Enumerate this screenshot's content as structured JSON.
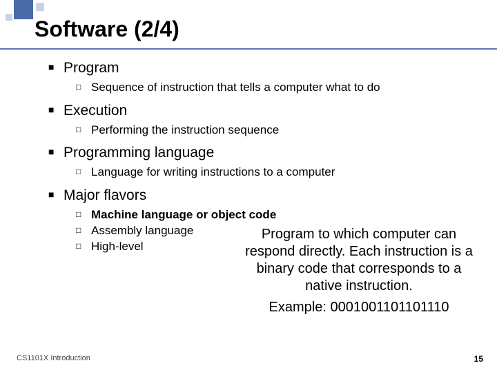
{
  "title": "Software (2/4)",
  "bullets": [
    {
      "label": "Program",
      "subs": [
        "Sequence of instruction that tells a computer what to do"
      ]
    },
    {
      "label": "Execution",
      "subs": [
        "Performing the instruction sequence"
      ]
    },
    {
      "label": "Programming language",
      "subs": [
        "Language for writing instructions to a computer"
      ]
    },
    {
      "label": "Major flavors",
      "subs": [
        "Machine language or object code",
        "Assembly language",
        "High-level"
      ]
    }
  ],
  "callout": {
    "body": "Program to which computer can respond directly. Each instruction is a binary code that corresponds to a native instruction.",
    "example_label": "Example:",
    "example_value": "0001001101101110"
  },
  "footer": "CS1101X Introduction",
  "pagenum": "15",
  "glyphs": {
    "b1": "■",
    "b2": "□"
  }
}
